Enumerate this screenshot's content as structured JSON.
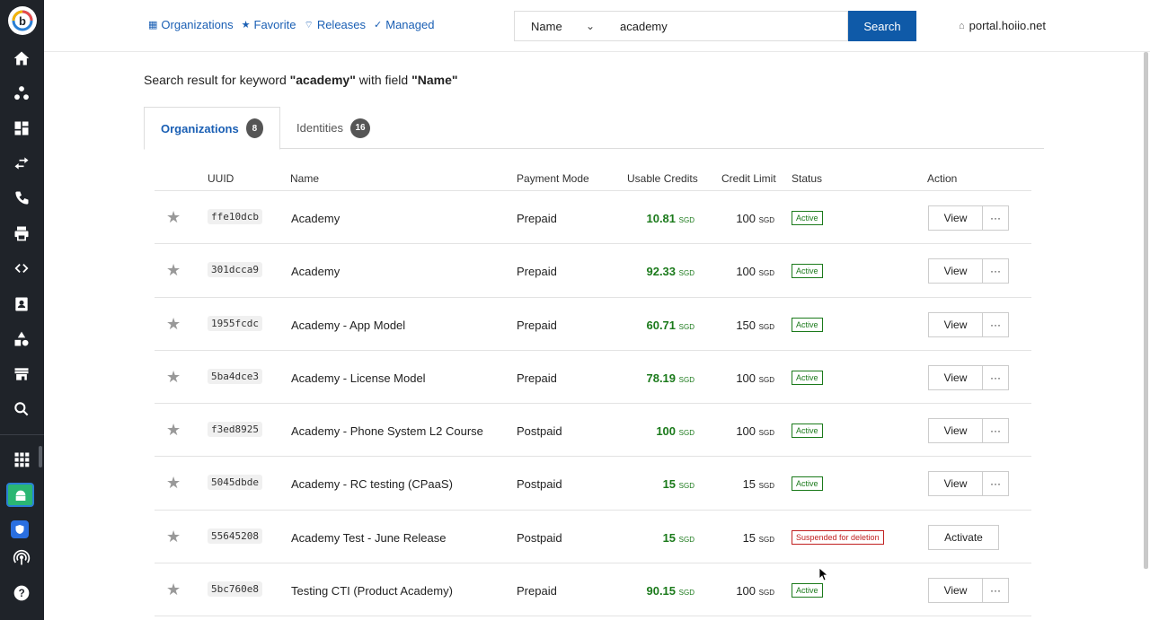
{
  "sidebar": {
    "items": [
      "home-icon",
      "hierarchy-icon",
      "dashboard-icon",
      "transfer-icon",
      "phone-icon",
      "printer-icon",
      "code-icon",
      "contacts-icon",
      "shapes-icon",
      "store-icon",
      "search-analytics-icon",
      "apps-grid-icon",
      "android-app-icon",
      "shield-app-icon",
      "broadcast-icon",
      "help-icon"
    ]
  },
  "nav": {
    "organizations": "Organizations",
    "favorite": "Favorite",
    "releases": "Releases",
    "managed": "Managed"
  },
  "search": {
    "field": "Name",
    "value": "academy",
    "button": "Search"
  },
  "portal": "portal.hoiio.net",
  "result": {
    "prefix": "Search result for keyword ",
    "keyword": "\"academy\"",
    "middle": " with field ",
    "field": "\"Name\""
  },
  "tabs": [
    {
      "label": "Organizations",
      "count": "8"
    },
    {
      "label": "Identities",
      "count": "16"
    }
  ],
  "columns": {
    "uuid": "UUID",
    "name": "Name",
    "payment": "Payment Mode",
    "credits": "Usable Credits",
    "limit": "Credit Limit",
    "status": "Status",
    "action": "Action"
  },
  "currency": "SGD",
  "rows": [
    {
      "uuid": "ffe10dcb",
      "name": "Academy",
      "payment": "Prepaid",
      "credits": "10.81",
      "limit": "100",
      "status": "Active",
      "action": "View"
    },
    {
      "uuid": "301dcca9",
      "name": "Academy",
      "payment": "Prepaid",
      "credits": "92.33",
      "limit": "100",
      "status": "Active",
      "action": "View"
    },
    {
      "uuid": "1955fcdc",
      "name": "Academy - App Model",
      "payment": "Prepaid",
      "credits": "60.71",
      "limit": "150",
      "status": "Active",
      "action": "View"
    },
    {
      "uuid": "5ba4dce3",
      "name": "Academy - License Model",
      "payment": "Prepaid",
      "credits": "78.19",
      "limit": "100",
      "status": "Active",
      "action": "View"
    },
    {
      "uuid": "f3ed8925",
      "name": "Academy - Phone System L2 Course",
      "payment": "Postpaid",
      "credits": "100",
      "limit": "100",
      "status": "Active",
      "action": "View"
    },
    {
      "uuid": "5045dbde",
      "name": "Academy - RC testing (CPaaS)",
      "payment": "Postpaid",
      "credits": "15",
      "limit": "15",
      "status": "Active",
      "action": "View"
    },
    {
      "uuid": "55645208",
      "name": "Academy Test - June Release",
      "payment": "Postpaid",
      "credits": "15",
      "limit": "15",
      "status": "Suspended for deletion",
      "action": "Activate"
    },
    {
      "uuid": "5bc760e8",
      "name": "Testing CTI (Product Academy)",
      "payment": "Prepaid",
      "credits": "90.15",
      "limit": "100",
      "status": "Active",
      "action": "View"
    }
  ],
  "more_label": "···"
}
